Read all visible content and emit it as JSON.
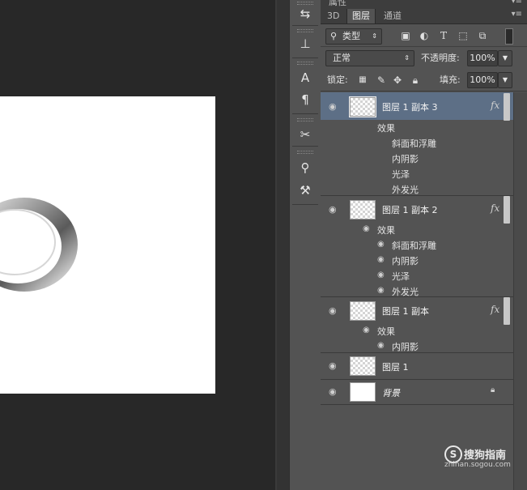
{
  "panel": {
    "header_title": "属性",
    "tabs": [
      {
        "label": "3D"
      },
      {
        "label": "图层"
      },
      {
        "label": "通道"
      }
    ],
    "filter_label": "类型",
    "blend_mode": "正常",
    "opacity_label": "不透明度:",
    "opacity_value": "100%",
    "lock_label": "锁定:",
    "fill_label": "填充:",
    "fill_value": "100%"
  },
  "layers": [
    {
      "name": "图层 1 副本 3",
      "selected": true,
      "effects_label": "效果",
      "effects": [
        "斜面和浮雕",
        "内阴影",
        "光泽",
        "外发光"
      ],
      "fx": "fx"
    },
    {
      "name": "图层 1 副本 2",
      "selected": false,
      "effects_label": "效果",
      "effects": [
        "斜面和浮雕",
        "内阴影",
        "光泽",
        "外发光"
      ],
      "fx": "fx"
    },
    {
      "name": "图层 1 副本",
      "selected": false,
      "effects_label": "效果",
      "effects": [
        "内阴影"
      ],
      "fx": "fx"
    },
    {
      "name": "图层 1",
      "selected": false
    },
    {
      "name": "背景",
      "selected": false,
      "locked": true
    }
  ],
  "icons": {
    "search": "search-icon",
    "eye": "eye-icon",
    "lock": "lock-icon",
    "fx": "fx-icon"
  },
  "watermark": {
    "brand": "搜狗指南",
    "url": "zhinan.sogou.com"
  }
}
